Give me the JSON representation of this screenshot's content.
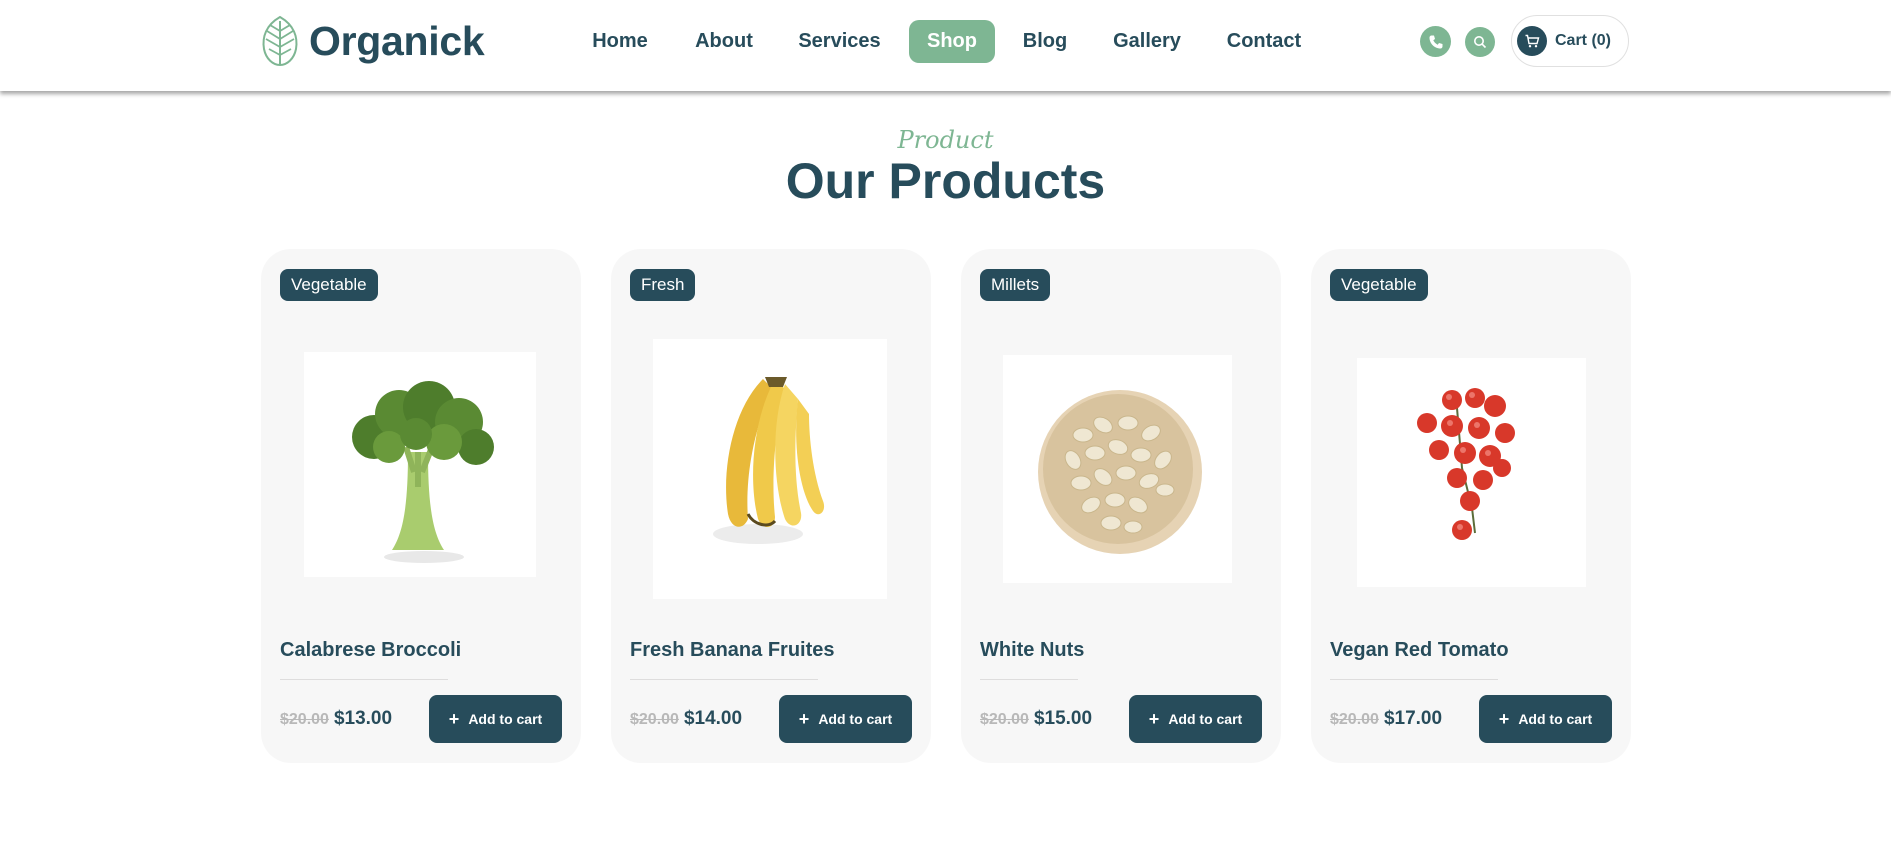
{
  "header": {
    "logo_text": "Organick",
    "nav": [
      {
        "label": "Home"
      },
      {
        "label": "About"
      },
      {
        "label": "Services"
      },
      {
        "label": "Shop",
        "active": true
      },
      {
        "label": "Blog"
      },
      {
        "label": "Gallery"
      },
      {
        "label": "Contact"
      }
    ],
    "cart_label": "Cart (0)",
    "icons": [
      "phone-icon",
      "search-icon",
      "cart-icon"
    ]
  },
  "section": {
    "subtitle": "Product",
    "title": "Our Products"
  },
  "products": [
    {
      "badge": "Vegetable",
      "name": "Calabrese Broccoli",
      "old_price": "$20.00",
      "price": "$13.00",
      "button": "Add to cart",
      "image": "broccoli-image"
    },
    {
      "badge": "Fresh",
      "name": "Fresh Banana Fruites",
      "old_price": "$20.00",
      "price": "$14.00",
      "button": "Add to cart",
      "image": "banana-image"
    },
    {
      "badge": "Millets",
      "name": "White Nuts",
      "old_price": "$20.00",
      "price": "$15.00",
      "button": "Add to cart",
      "image": "nuts-bowl-image"
    },
    {
      "badge": "Vegetable",
      "name": "Vegan Red Tomato",
      "old_price": "$20.00",
      "price": "$17.00",
      "button": "Add to cart",
      "image": "tomato-image"
    }
  ],
  "colors": {
    "primary": "#274c5b",
    "accent": "#7eb693",
    "card_bg": "#f7f7f7"
  }
}
